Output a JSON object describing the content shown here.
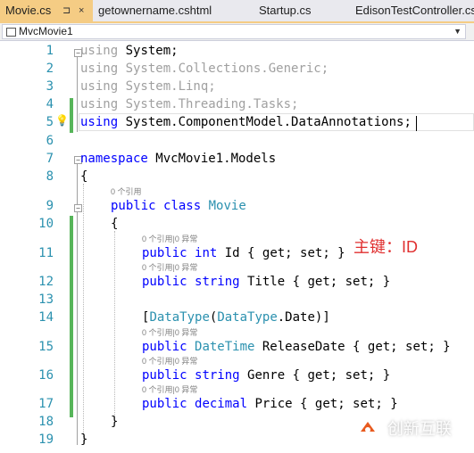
{
  "tabs": [
    {
      "label": "Movie.cs",
      "pin": "⊐",
      "close": "×",
      "active": true
    },
    {
      "label": "getownername.cshtml"
    },
    {
      "label": "Startup.cs"
    },
    {
      "label": "EdisonTestController.cs"
    }
  ],
  "navbar": {
    "project": "MvcMovie1",
    "dropdown_icon": "chevron-down-icon"
  },
  "line_numbers": [
    "1",
    "2",
    "3",
    "4",
    "5",
    "6",
    "7",
    "8",
    "9",
    "10",
    "11",
    "12",
    "13",
    "14",
    "15",
    "16",
    "17",
    "18",
    "19"
  ],
  "code": {
    "l1": {
      "kw": "using",
      "rest": " System;"
    },
    "l2": "using System.Collections.Generic;",
    "l3": "using System.Linq;",
    "l4": "using System.Threading.Tasks;",
    "l5": {
      "kw": "using",
      "rest": " System.ComponentModel.DataAnnotations;"
    },
    "l7": {
      "kw": "namespace",
      "rest": " MvcMovie1.Models"
    },
    "l8": "{",
    "l9": {
      "kw1": "public",
      "kw2": "class",
      "type": "Movie"
    },
    "l10": "{",
    "l11": {
      "kw1": "public",
      "kw2": "int",
      "name": " Id ",
      "body": "{ get; set; }"
    },
    "l12": {
      "kw1": "public",
      "kw2": "string",
      "name": " Title ",
      "body": "{ get; set; }"
    },
    "l14": {
      "open": "[",
      "type1": "DataType",
      "paren": "(",
      "type2": "DataType",
      "rest": ".Date)]"
    },
    "l15": {
      "kw1": "public",
      "type": "DateTime",
      "name": " ReleaseDate ",
      "body": "{ get; set; }"
    },
    "l16": {
      "kw1": "public",
      "kw2": "string",
      "name": " Genre ",
      "body": "{ get; set; }"
    },
    "l17": {
      "kw1": "public",
      "kw2": "decimal",
      "name": " Price ",
      "body": "{ get; set; }"
    },
    "l18": "}",
    "l19": "}"
  },
  "hints": {
    "class_ref": "0 个引用",
    "prop_ref": "0 个引用|0 异常"
  },
  "annotation": "主键：ID",
  "watermark": {
    "text": "创新互联"
  },
  "colors": {
    "keyword": "#0000ff",
    "type": "#2b91af",
    "annotation": "#e03030",
    "tab_active": "#f5cc84",
    "change_bar": "#57b55a"
  }
}
